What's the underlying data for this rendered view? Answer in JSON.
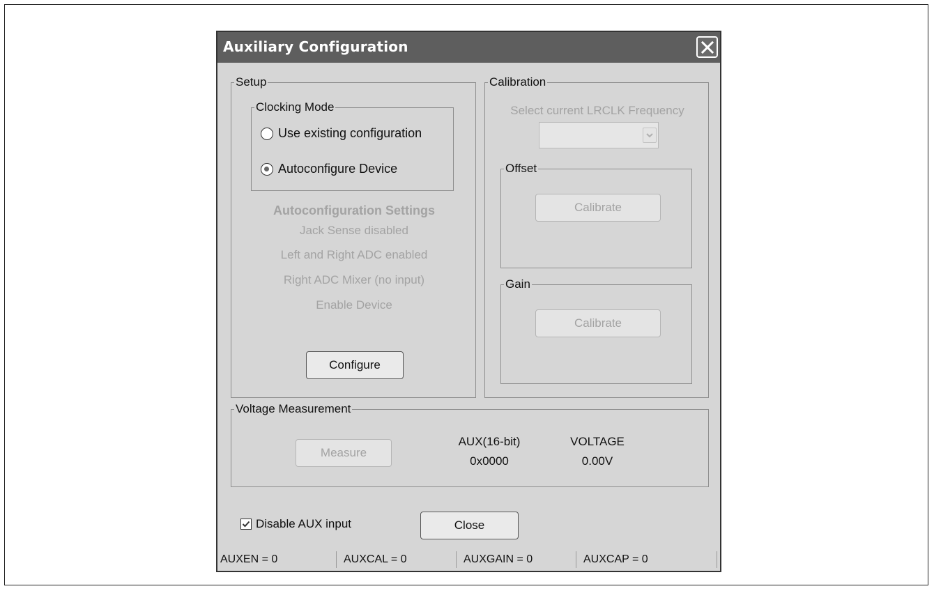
{
  "window": {
    "title": "Auxiliary Configuration",
    "close_icon": "close-icon"
  },
  "setup": {
    "legend": "Setup",
    "clocking_mode": {
      "legend": "Clocking Mode",
      "options": [
        "Use existing configuration",
        "Autoconfigure Device"
      ],
      "selected": "Autoconfigure Device"
    },
    "autoconfig": {
      "heading": "Autoconfiguration Settings",
      "lines": [
        "Jack Sense disabled",
        "Left and Right ADC enabled",
        "Right ADC Mixer (no input)",
        "Enable Device"
      ]
    },
    "configure_label": "Configure"
  },
  "calibration": {
    "legend": "Calibration",
    "select_label": "Select current LRCLK Frequency",
    "select_value": "",
    "offset": {
      "legend": "Offset",
      "button": "Calibrate"
    },
    "gain": {
      "legend": "Gain",
      "button": "Calibrate"
    }
  },
  "voltage": {
    "legend": "Voltage Measurement",
    "measure_label": "Measure",
    "aux_header": "AUX(16-bit)",
    "aux_value": "0x0000",
    "voltage_header": "VOLTAGE",
    "voltage_value": "0.00V"
  },
  "footer": {
    "disable_aux_label": "Disable AUX input",
    "disable_aux_checked": true,
    "close_label": "Close"
  },
  "status": [
    "AUXEN = 0",
    "AUXCAL = 0",
    "AUXGAIN = 0",
    "AUXCAP = 0"
  ]
}
